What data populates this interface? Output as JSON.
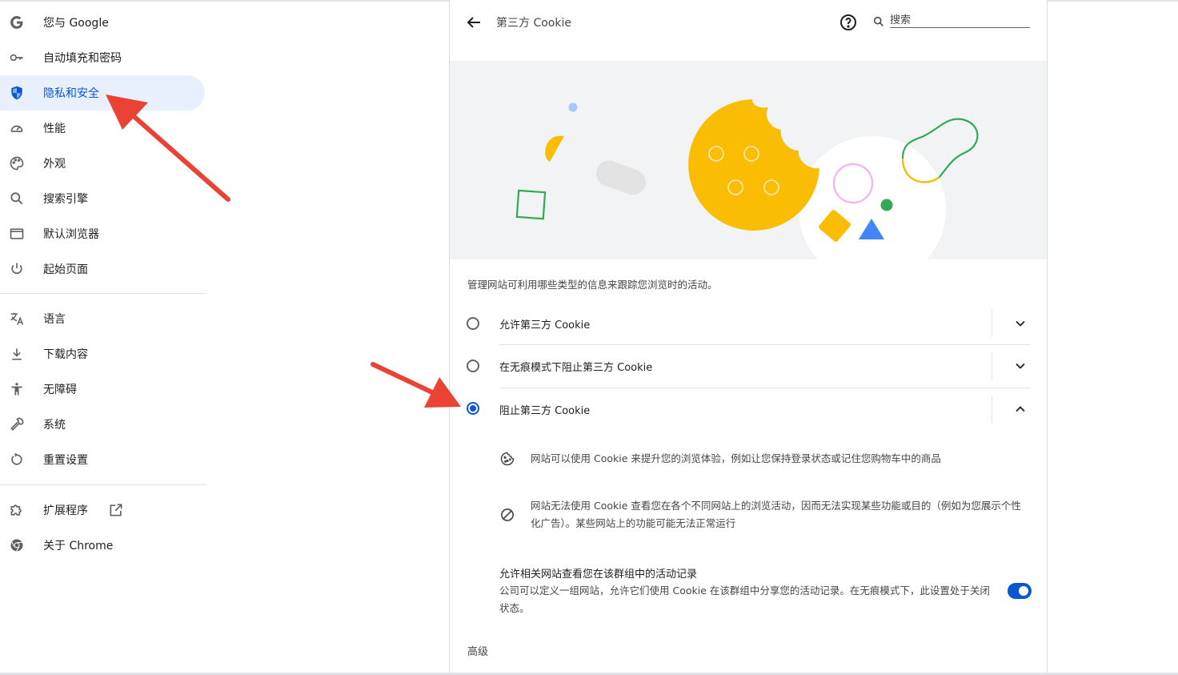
{
  "sidebar": {
    "items": [
      {
        "label": "您与 Google",
        "icon": "google-g-icon",
        "active": false
      },
      {
        "label": "自动填充和密码",
        "icon": "key-icon",
        "active": false
      },
      {
        "label": "隐私和安全",
        "icon": "shield-icon",
        "active": true
      },
      {
        "label": "性能",
        "icon": "speedometer-icon",
        "active": false
      },
      {
        "label": "外观",
        "icon": "palette-icon",
        "active": false
      },
      {
        "label": "搜索引擎",
        "icon": "search-icon",
        "active": false
      },
      {
        "label": "默认浏览器",
        "icon": "browser-window-icon",
        "active": false
      },
      {
        "label": "起始页面",
        "icon": "power-icon",
        "active": false
      },
      {
        "label": "语言",
        "icon": "translate-icon",
        "active": false
      },
      {
        "label": "下载内容",
        "icon": "download-icon",
        "active": false
      },
      {
        "label": "无障碍",
        "icon": "accessibility-icon",
        "active": false
      },
      {
        "label": "系统",
        "icon": "wrench-icon",
        "active": false
      },
      {
        "label": "重置设置",
        "icon": "reset-icon",
        "active": false
      },
      {
        "label": "扩展程序",
        "icon": "puzzle-icon",
        "active": false,
        "external_icon": "open-in-new-icon"
      },
      {
        "label": "关于 Chrome",
        "icon": "chrome-icon",
        "active": false
      }
    ]
  },
  "header": {
    "title": "第三方 Cookie",
    "search_placeholder": "搜索"
  },
  "description": "管理网站可利用哪些类型的信息来跟踪您浏览时的活动。",
  "options": [
    {
      "label": "允许第三方 Cookie",
      "selected": false,
      "expanded": false
    },
    {
      "label": "在无痕模式下阻止第三方 Cookie",
      "selected": false,
      "expanded": false
    },
    {
      "label": "阻止第三方 Cookie",
      "selected": true,
      "expanded": true
    }
  ],
  "details": [
    {
      "icon": "cookie-icon",
      "text": "网站可以使用 Cookie 来提升您的浏览体验，例如让您保持登录状态或记住您购物车中的商品"
    },
    {
      "icon": "block-icon",
      "text": "网站无法使用 Cookie 查看您在各个不同网站上的浏览活动，因而无法实现某些功能或目的（例如为您展示个性化广告）。某些网站上的功能可能无法正常运行"
    }
  ],
  "related_sites": {
    "title": "允许相关网站查看您在该群组中的活动记录",
    "description": "公司可以定义一组网站，允许它们使用 Cookie 在该群组中分享您的活动记录。在无痕模式下，此设置处于关闭状态。",
    "enabled": true
  },
  "advanced_label": "高级",
  "colors": {
    "accent": "#0b57d0",
    "active_bg": "#e8effd",
    "annotation_arrow": "#ea4335",
    "cookie_yellow": "#fbbc04",
    "hero_bg": "#f1f3f4"
  }
}
